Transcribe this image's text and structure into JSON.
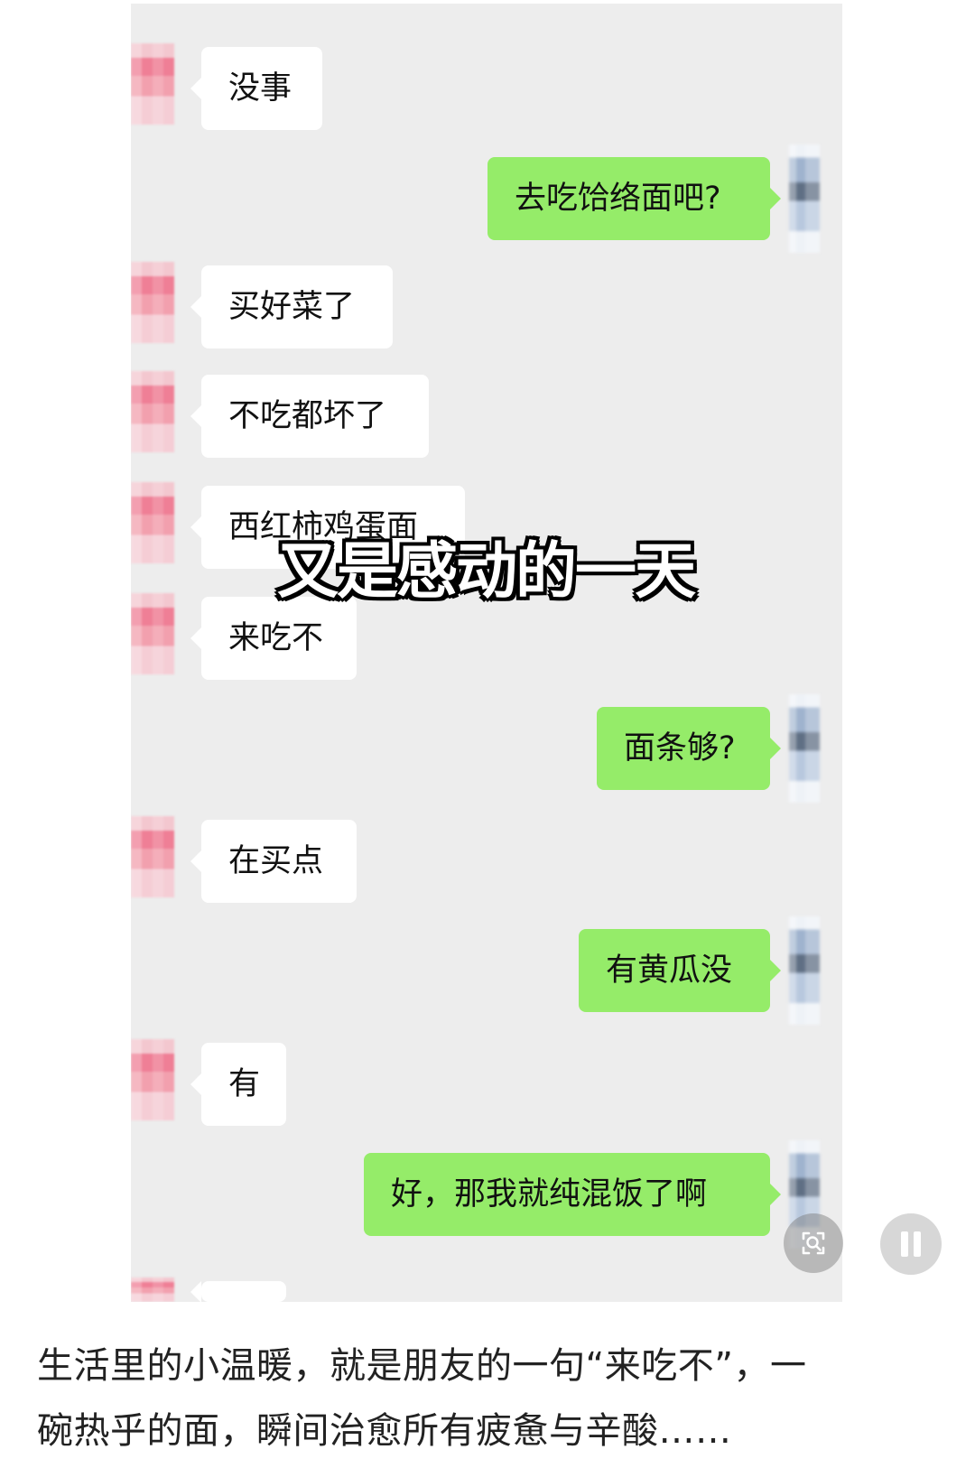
{
  "overlay": {
    "title": "又是感动的一天"
  },
  "messages": [
    {
      "side": "left",
      "text": "没事"
    },
    {
      "side": "right",
      "text": "去吃饸络面吧?"
    },
    {
      "side": "left",
      "text": "买好菜了"
    },
    {
      "side": "left",
      "text": "不吃都坏了"
    },
    {
      "side": "left",
      "text": "西红柿鸡蛋面"
    },
    {
      "side": "left",
      "text": "来吃不"
    },
    {
      "side": "right",
      "text": "面条够?"
    },
    {
      "side": "left",
      "text": "在买点"
    },
    {
      "side": "right",
      "text": "有黄瓜没"
    },
    {
      "side": "left",
      "text": "有"
    },
    {
      "side": "right",
      "text": "好，那我就纯混饭了啊"
    }
  ],
  "controls": {
    "scan_icon": "scan-icon",
    "pause_icon": "pause-icon"
  },
  "caption": {
    "line1": "生活里的小温暖，就是朋友的一句“来吃不”，一",
    "line2": "碗热乎的面，瞬间治愈所有疲惫与辛酸……"
  }
}
